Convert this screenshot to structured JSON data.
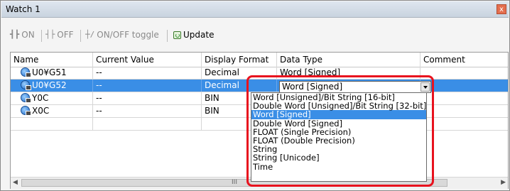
{
  "window": {
    "title": "Watch 1",
    "close_glyph": "x"
  },
  "toolbar": {
    "on_label": "ON",
    "off_label": "OFF",
    "toggle_label": "ON/OFF toggle",
    "update_label": "Update"
  },
  "table": {
    "columns": [
      "Name",
      "Current Value",
      "Display Format",
      "Data Type",
      "Comment"
    ],
    "rows": [
      {
        "name": "U0¥G51",
        "value": "--",
        "format": "Decimal",
        "type": "Word [Signed]",
        "comment": ""
      },
      {
        "name": "U0¥G52",
        "value": "--",
        "format": "Decimal",
        "type": "",
        "comment": ""
      },
      {
        "name": "Y0C",
        "value": "--",
        "format": "BIN",
        "type": "",
        "comment": ""
      },
      {
        "name": "X0C",
        "value": "--",
        "format": "BIN",
        "type": "",
        "comment": ""
      }
    ]
  },
  "dropdown": {
    "selected": "Word [Signed]",
    "options": [
      "Word [Unsigned]/Bit String [16-bit]",
      "Double Word [Unsigned]/Bit String [32-bit]",
      "Word [Signed]",
      "Double Word [Signed]",
      "FLOAT (Single Precision)",
      "FLOAT (Double Precision)",
      "String",
      "String [Unicode]",
      "Time"
    ]
  },
  "scrollbar": {
    "thumb_grip": "III"
  },
  "colors": {
    "selection": "#3a8ee6",
    "highlight_border": "#e8121e"
  }
}
